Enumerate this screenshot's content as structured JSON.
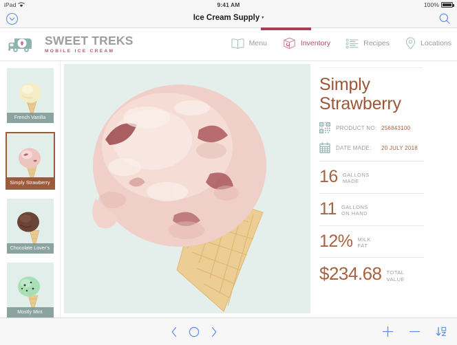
{
  "status_bar": {
    "device": "iPad",
    "wifi_icon": "wifi-icon",
    "time": "9:41 AM",
    "battery_percent": "100%",
    "battery_icon": "battery-full-icon"
  },
  "navbar": {
    "back_icon": "chevron-down-circle-icon",
    "title": "Ice Cream Supply",
    "title_caret": "▾",
    "search_icon": "search-icon",
    "progress_color": "#a83f56"
  },
  "brand": {
    "icon": "ice-cream-truck-icon",
    "name": "SWEET TREKS",
    "tagline": "MOBILE ICE CREAM",
    "name_color": "#9e9e9e",
    "tagline_color": "#b9566b"
  },
  "tabs": [
    {
      "label": "Menu",
      "icon": "book-icon",
      "active": false
    },
    {
      "label": "Inventory",
      "icon": "box-icon",
      "active": true
    },
    {
      "label": "Recipes",
      "icon": "list-icon",
      "active": false
    },
    {
      "label": "Locations",
      "icon": "map-pin-icon",
      "active": false
    }
  ],
  "active_tab_color": "#b24a5f",
  "sidebar": {
    "items": [
      {
        "label": "French Vanilla",
        "selected": false
      },
      {
        "label": "Simply Strawberry",
        "selected": true
      },
      {
        "label": "Chocolate Lover's",
        "selected": false
      },
      {
        "label": "Mostly Mint",
        "selected": false
      }
    ]
  },
  "main_image": {
    "alt": "strawberry-ice-cream-cone-photo",
    "background": "#e4efec"
  },
  "info": {
    "title_line1": "Simply",
    "title_line2": "Strawberry",
    "title_color": "#9c5636",
    "meta": [
      {
        "icon": "qr-code-icon",
        "label": "PRODUCT NO:",
        "value": "256843100"
      },
      {
        "icon": "calendar-icon",
        "label": "DATE MADE:",
        "value": "20 JULY 2018"
      }
    ],
    "stats": [
      {
        "value": "16",
        "label_line1": "GALLONS",
        "label_line2": "MADE"
      },
      {
        "value": "11",
        "label_line1": "GALLONS",
        "label_line2": "ON HAND"
      },
      {
        "value": "12%",
        "label_line1": "MILK",
        "label_line2": "FAT"
      },
      {
        "value": "$234.68",
        "label_line1": "TOTAL",
        "label_line2": "VALUE"
      }
    ]
  },
  "toolbar": {
    "prev_icon": "chevron-left-icon",
    "record_icon": "circle-icon",
    "next_icon": "chevron-right-icon",
    "add_icon": "plus-icon",
    "remove_icon": "minus-icon",
    "sort_icon": "sort-az-icon",
    "tint": "#5b8df0"
  }
}
